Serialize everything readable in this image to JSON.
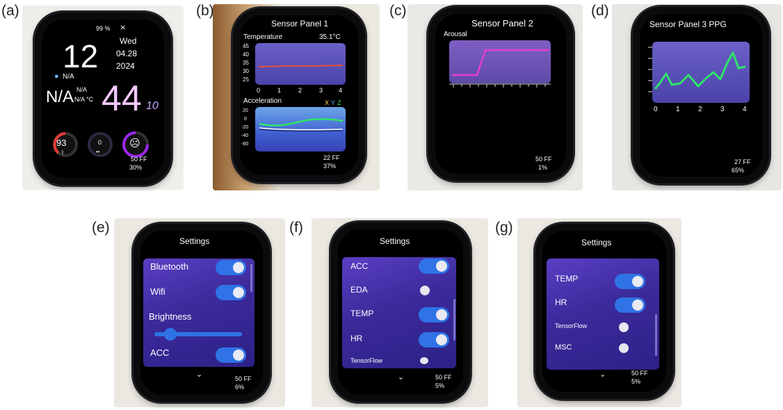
{
  "panels": {
    "a": {
      "label": "(a)",
      "battery": "99 %",
      "hour": "12",
      "day": "Wed",
      "date": "04.28",
      "year": "2024",
      "location": "N/A",
      "big_na": "N/A",
      "small_na1": "N/A",
      "small_na2": "N/A °C",
      "minutes": "44",
      "seconds": "10",
      "heart": "93",
      "steps": "0",
      "temp": "50 FF",
      "pct": "30% "
    },
    "b": {
      "label": "(b)",
      "title": "Sensor Panel 1",
      "temp_label": "Temperature",
      "temp_value": "35.1°C",
      "y_ticks": [
        "45",
        "40",
        "35",
        "30",
        "25"
      ],
      "x_ticks": [
        "0",
        "1",
        "2",
        "3",
        "4"
      ],
      "acc_label": "Acceleration",
      "acc_x": "X",
      "acc_y": "Y",
      "acc_z": "Z",
      "acc_ticks": [
        "20",
        "0",
        "-20",
        "-40",
        "-60"
      ],
      "temp": "22 FF",
      "pct": "37% "
    },
    "c": {
      "label": "(c)",
      "title": "Sensor Panel 2",
      "arousal_label": "Arousal",
      "temp": "50 FF",
      "pct": "1% "
    },
    "d": {
      "label": "(d)",
      "title": "Sensor Panel 3 PPG",
      "x_ticks": [
        "0",
        "1",
        "2",
        "3",
        "4"
      ],
      "temp": "27 FF",
      "pct": "65% "
    },
    "e": {
      "label": "(e)",
      "title": "Settings",
      "items": [
        "Bluetooth",
        "Wifi",
        "Brightness",
        "ACC"
      ],
      "temp": "50 FF",
      "pct": "6% "
    },
    "f": {
      "label": "(f)",
      "title": "Settings",
      "items": [
        "ACC",
        "EDA",
        "TEMP",
        "HR",
        "TensorFlow"
      ],
      "temp": "50 FF",
      "pct": "5% "
    },
    "g": {
      "label": "(g)",
      "title": "Settings",
      "items": [
        "TEMP",
        "HR",
        "TensorFlow",
        "MSC"
      ],
      "temp": "50 FF",
      "pct": "5% "
    }
  },
  "colors": {
    "accent_blue": "#2f73e6",
    "plot_purple": "#5a52b8",
    "arousal_line": "#e83bd0",
    "ppg_line": "#2ee66a",
    "temp_line": "#e5533a",
    "heart_ring": "#e53935",
    "emotion_ring": "#9c27f0"
  }
}
